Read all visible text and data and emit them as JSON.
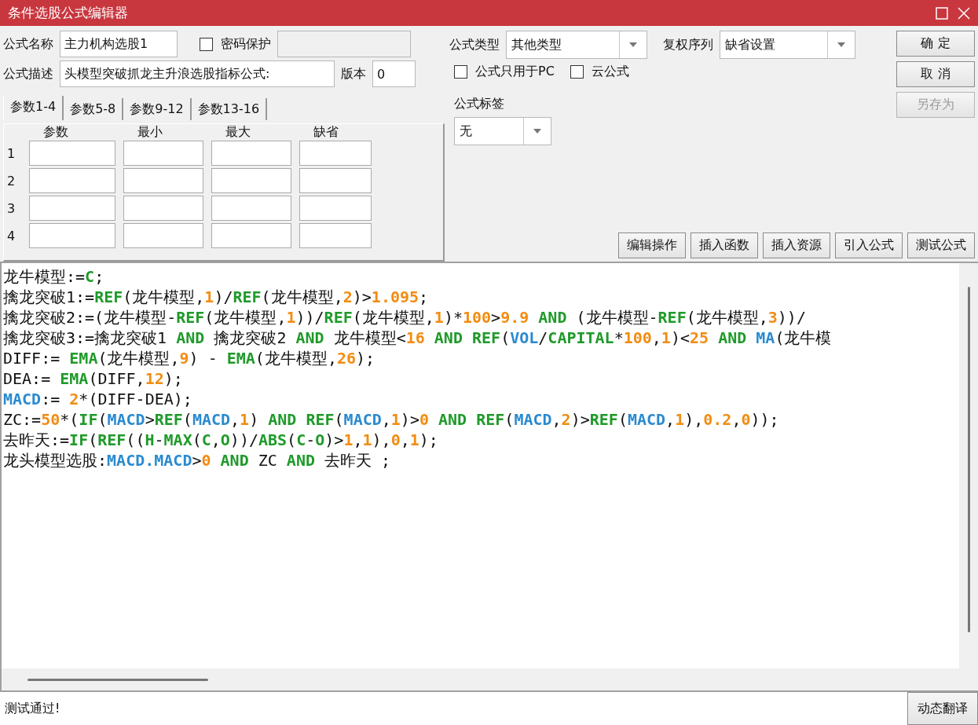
{
  "window": {
    "title": "条件选股公式编辑器"
  },
  "form": {
    "name_label": "公式名称",
    "name_value": "主力机构选股1",
    "password": {
      "label": "密码保护",
      "checked": false
    },
    "desc_label": "公式描述",
    "desc_value": "头模型突破抓龙主升浪选股指标公式:",
    "version_label": "版本",
    "version_value": "0"
  },
  "type_field": {
    "label": "公式类型",
    "value": "其他类型"
  },
  "rights_field": {
    "label": "复权序列",
    "value": "缺省设置"
  },
  "options": [
    {
      "label": "公式只用于PC",
      "checked": false
    },
    {
      "label": "云公式",
      "checked": false
    }
  ],
  "tag_field": {
    "label": "公式标签",
    "value": "无"
  },
  "side_buttons": [
    {
      "label": "确 定",
      "disabled": false
    },
    {
      "label": "取 消",
      "disabled": false
    },
    {
      "label": "另存为",
      "disabled": true
    }
  ],
  "tabs": [
    {
      "label": "参数1-4",
      "selected": true
    },
    {
      "label": "参数5-8",
      "selected": false
    },
    {
      "label": "参数9-12",
      "selected": false
    },
    {
      "label": "参数13-16",
      "selected": false
    }
  ],
  "params": {
    "columns": [
      "参数",
      "最小",
      "最大",
      "缺省"
    ],
    "rows": [
      "1",
      "2",
      "3",
      "4"
    ]
  },
  "tool_buttons": [
    "编辑操作",
    "插入函数",
    "插入资源",
    "引入公式",
    "测试公式"
  ],
  "code_lines": [
    [
      {
        "text": "龙牛模型:=",
        "kind": "plain"
      },
      {
        "text": "C",
        "kind": "func"
      },
      {
        "text": ";",
        "kind": "plain"
      }
    ],
    [
      {
        "text": "擒龙突破1:=",
        "kind": "plain"
      },
      {
        "text": "REF",
        "kind": "func"
      },
      {
        "text": "(龙牛模型,",
        "kind": "plain"
      },
      {
        "text": "1",
        "kind": "num"
      },
      {
        "text": ")/",
        "kind": "plain"
      },
      {
        "text": "REF",
        "kind": "func"
      },
      {
        "text": "(龙牛模型,",
        "kind": "plain"
      },
      {
        "text": "2",
        "kind": "num"
      },
      {
        "text": ")>",
        "kind": "plain"
      },
      {
        "text": "1.095",
        "kind": "num"
      },
      {
        "text": ";",
        "kind": "plain"
      }
    ],
    [
      {
        "text": "擒龙突破2:=(龙牛模型-",
        "kind": "plain"
      },
      {
        "text": "REF",
        "kind": "func"
      },
      {
        "text": "(龙牛模型,",
        "kind": "plain"
      },
      {
        "text": "1",
        "kind": "num"
      },
      {
        "text": "))/",
        "kind": "plain"
      },
      {
        "text": "REF",
        "kind": "func"
      },
      {
        "text": "(龙牛模型,",
        "kind": "plain"
      },
      {
        "text": "1",
        "kind": "num"
      },
      {
        "text": ")*",
        "kind": "plain"
      },
      {
        "text": "100",
        "kind": "num"
      },
      {
        "text": ">",
        "kind": "plain"
      },
      {
        "text": "9.9",
        "kind": "num"
      },
      {
        "text": " AND",
        "kind": "func"
      },
      {
        "text": " (龙牛模型-",
        "kind": "plain"
      },
      {
        "text": "REF",
        "kind": "func"
      },
      {
        "text": "(龙牛模型,",
        "kind": "plain"
      },
      {
        "text": "3",
        "kind": "num"
      },
      {
        "text": "))/",
        "kind": "plain"
      }
    ],
    [
      {
        "text": "擒龙突破3:=擒龙突破1 ",
        "kind": "plain"
      },
      {
        "text": "AND",
        "kind": "func"
      },
      {
        "text": " 擒龙突破2 ",
        "kind": "plain"
      },
      {
        "text": "AND",
        "kind": "func"
      },
      {
        "text": " 龙牛模型<",
        "kind": "plain"
      },
      {
        "text": "16",
        "kind": "num"
      },
      {
        "text": " AND ",
        "kind": "func"
      },
      {
        "text": "REF",
        "kind": "func"
      },
      {
        "text": "(",
        "kind": "plain"
      },
      {
        "text": "VOL",
        "kind": "var"
      },
      {
        "text": "/",
        "kind": "plain"
      },
      {
        "text": "CAPITAL",
        "kind": "func"
      },
      {
        "text": "*",
        "kind": "plain"
      },
      {
        "text": "100",
        "kind": "num"
      },
      {
        "text": ",",
        "kind": "plain"
      },
      {
        "text": "1",
        "kind": "num"
      },
      {
        "text": ")<",
        "kind": "plain"
      },
      {
        "text": "25",
        "kind": "num"
      },
      {
        "text": " AND ",
        "kind": "func"
      },
      {
        "text": "MA",
        "kind": "var"
      },
      {
        "text": "(龙牛模",
        "kind": "plain"
      }
    ],
    [
      {
        "text": "DIFF:= ",
        "kind": "plain"
      },
      {
        "text": "EMA",
        "kind": "func"
      },
      {
        "text": "(龙牛模型,",
        "kind": "plain"
      },
      {
        "text": "9",
        "kind": "num"
      },
      {
        "text": ") - ",
        "kind": "plain"
      },
      {
        "text": "EMA",
        "kind": "func"
      },
      {
        "text": "(龙牛模型,",
        "kind": "plain"
      },
      {
        "text": "26",
        "kind": "num"
      },
      {
        "text": ");",
        "kind": "plain"
      }
    ],
    [
      {
        "text": "DEA:= ",
        "kind": "plain"
      },
      {
        "text": "EMA",
        "kind": "func"
      },
      {
        "text": "(DIFF,",
        "kind": "plain"
      },
      {
        "text": "12",
        "kind": "num"
      },
      {
        "text": ");",
        "kind": "plain"
      }
    ],
    [
      {
        "text": "MACD",
        "kind": "var"
      },
      {
        "text": ":= ",
        "kind": "plain"
      },
      {
        "text": "2",
        "kind": "num"
      },
      {
        "text": "*(DIFF-DEA);",
        "kind": "plain"
      }
    ],
    [
      {
        "text": "ZC:=",
        "kind": "plain"
      },
      {
        "text": "50",
        "kind": "num"
      },
      {
        "text": "*(",
        "kind": "plain"
      },
      {
        "text": "IF",
        "kind": "func"
      },
      {
        "text": "(",
        "kind": "plain"
      },
      {
        "text": "MACD",
        "kind": "var"
      },
      {
        "text": ">",
        "kind": "plain"
      },
      {
        "text": "REF",
        "kind": "func"
      },
      {
        "text": "(",
        "kind": "plain"
      },
      {
        "text": "MACD",
        "kind": "var"
      },
      {
        "text": ",",
        "kind": "plain"
      },
      {
        "text": "1",
        "kind": "num"
      },
      {
        "text": ") ",
        "kind": "plain"
      },
      {
        "text": "AND ",
        "kind": "func"
      },
      {
        "text": "REF",
        "kind": "func"
      },
      {
        "text": "(",
        "kind": "plain"
      },
      {
        "text": "MACD",
        "kind": "var"
      },
      {
        "text": ",",
        "kind": "plain"
      },
      {
        "text": "1",
        "kind": "num"
      },
      {
        "text": ")>",
        "kind": "plain"
      },
      {
        "text": "0",
        "kind": "num"
      },
      {
        "text": " AND ",
        "kind": "func"
      },
      {
        "text": "REF",
        "kind": "func"
      },
      {
        "text": "(",
        "kind": "plain"
      },
      {
        "text": "MACD",
        "kind": "var"
      },
      {
        "text": ",",
        "kind": "plain"
      },
      {
        "text": "2",
        "kind": "num"
      },
      {
        "text": ")>",
        "kind": "plain"
      },
      {
        "text": "REF",
        "kind": "func"
      },
      {
        "text": "(",
        "kind": "plain"
      },
      {
        "text": "MACD",
        "kind": "var"
      },
      {
        "text": ",",
        "kind": "plain"
      },
      {
        "text": "1",
        "kind": "num"
      },
      {
        "text": "),",
        "kind": "plain"
      },
      {
        "text": "0.2",
        "kind": "num"
      },
      {
        "text": ",",
        "kind": "plain"
      },
      {
        "text": "0",
        "kind": "num"
      },
      {
        "text": "));",
        "kind": "plain"
      }
    ],
    [
      {
        "text": "去昨天:=",
        "kind": "plain"
      },
      {
        "text": "IF",
        "kind": "func"
      },
      {
        "text": "(",
        "kind": "plain"
      },
      {
        "text": "REF",
        "kind": "func"
      },
      {
        "text": "((",
        "kind": "plain"
      },
      {
        "text": "H",
        "kind": "func"
      },
      {
        "text": "-",
        "kind": "plain"
      },
      {
        "text": "MAX",
        "kind": "func"
      },
      {
        "text": "(",
        "kind": "plain"
      },
      {
        "text": "C",
        "kind": "func"
      },
      {
        "text": ",",
        "kind": "plain"
      },
      {
        "text": "O",
        "kind": "func"
      },
      {
        "text": "))/",
        "kind": "plain"
      },
      {
        "text": "ABS",
        "kind": "func"
      },
      {
        "text": "(",
        "kind": "plain"
      },
      {
        "text": "C",
        "kind": "func"
      },
      {
        "text": "-",
        "kind": "plain"
      },
      {
        "text": "O",
        "kind": "func"
      },
      {
        "text": ")>",
        "kind": "plain"
      },
      {
        "text": "1",
        "kind": "num"
      },
      {
        "text": ",",
        "kind": "plain"
      },
      {
        "text": "1",
        "kind": "num"
      },
      {
        "text": "),",
        "kind": "plain"
      },
      {
        "text": "0",
        "kind": "num"
      },
      {
        "text": ",",
        "kind": "plain"
      },
      {
        "text": "1",
        "kind": "num"
      },
      {
        "text": ");",
        "kind": "plain"
      }
    ],
    [
      {
        "text": "龙头模型选股:",
        "kind": "plain"
      },
      {
        "text": "MACD.MACD",
        "kind": "var"
      },
      {
        "text": ">",
        "kind": "plain"
      },
      {
        "text": "0",
        "kind": "num"
      },
      {
        "text": " AND",
        "kind": "func"
      },
      {
        "text": " ZC ",
        "kind": "plain"
      },
      {
        "text": "AND",
        "kind": "func"
      },
      {
        "text": " 去昨天 ;",
        "kind": "plain"
      }
    ]
  ],
  "status": {
    "message": "测试通过!",
    "button": "动态翻译"
  }
}
